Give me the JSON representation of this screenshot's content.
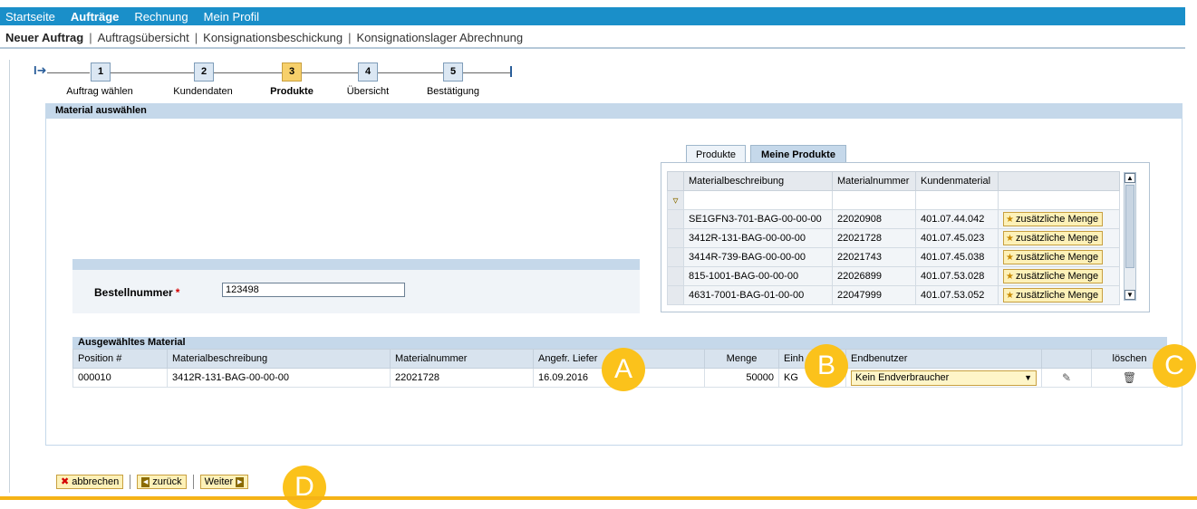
{
  "topnav": {
    "items": [
      "Startseite",
      "Aufträge",
      "Rechnung",
      "Mein Profil"
    ]
  },
  "subnav": {
    "items": [
      "Neuer Auftrag",
      "Auftragsübersicht",
      "Konsignationsbeschickung",
      "Konsignationslager Abrechnung"
    ]
  },
  "roadmap": {
    "steps": [
      {
        "num": "1",
        "label": "Auftrag wählen"
      },
      {
        "num": "2",
        "label": "Kundendaten"
      },
      {
        "num": "3",
        "label": "Produkte"
      },
      {
        "num": "4",
        "label": "Übersicht"
      },
      {
        "num": "5",
        "label": "Bestätigung"
      }
    ],
    "current": "3"
  },
  "panel": {
    "title": "Material auswählen"
  },
  "product_tabs": {
    "tab1": "Produkte",
    "tab2": "Meine Produkte",
    "selected": "Meine Produkte"
  },
  "product_table": {
    "headers": [
      "Materialbeschreibung",
      "Materialnummer",
      "Kundenmaterial"
    ],
    "button_label": "zusätzliche Menge",
    "rows": [
      {
        "desc": "SE1GFN3-701-BAG-00-00-00",
        "matnr": "22020908",
        "kunde": "401.07.44.042"
      },
      {
        "desc": "3412R-131-BAG-00-00-00",
        "matnr": "22021728",
        "kunde": "401.07.45.023"
      },
      {
        "desc": "3414R-739-BAG-00-00-00",
        "matnr": "22021743",
        "kunde": "401.07.45.038"
      },
      {
        "desc": "815-1001-BAG-00-00-00",
        "matnr": "22026899",
        "kunde": "401.07.53.028"
      },
      {
        "desc": "4631-7001-BAG-01-00-00",
        "matnr": "22047999",
        "kunde": "401.07.53.052"
      }
    ]
  },
  "bestell": {
    "label": "Bestellnummer",
    "required_mark": "*",
    "value": "123498"
  },
  "selected_material": {
    "title": "Ausgewähltes Material",
    "headers": [
      "Position #",
      "Materialbeschreibung",
      "Materialnummer",
      "Angefr. Liefer",
      "Menge",
      "Einh",
      "Endbenutzer",
      "",
      "löschen"
    ],
    "row": {
      "position": "000010",
      "desc": "3412R-131-BAG-00-00-00",
      "matnr": "22021728",
      "date": "16.09.2016",
      "menge": "50000",
      "einh": "KG",
      "endbenutzer": "Kein Endverbraucher"
    }
  },
  "callouts": [
    "A",
    "B",
    "C",
    "D"
  ],
  "buttons": {
    "cancel": "abbrechen",
    "back": "zurück",
    "next": "Weiter"
  },
  "colors": {
    "topnav": "#1a8fc9",
    "accent": "#fbc21b",
    "panel_header": "#c5d8ea"
  }
}
